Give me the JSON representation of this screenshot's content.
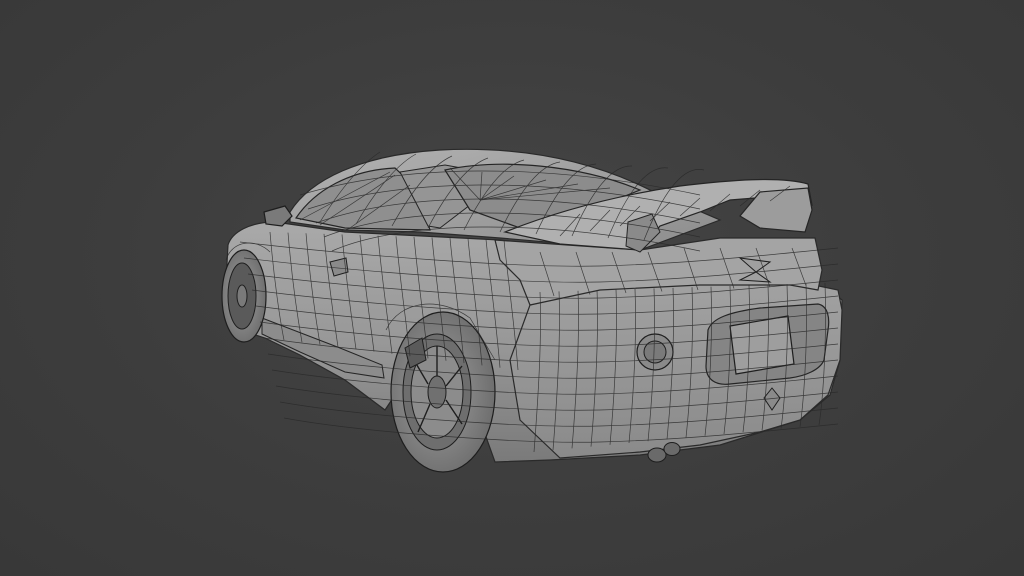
{
  "viewport": {
    "background_color": "#3d3d3d",
    "mesh_fill_color": "#9a9a9a",
    "mesh_highlight_color": "#b4b4b4",
    "mesh_shadow_color": "#6e6e6e",
    "wire_color": "#2a2a2a",
    "shading_mode": "solid-with-wireframe",
    "object": "car-model"
  }
}
